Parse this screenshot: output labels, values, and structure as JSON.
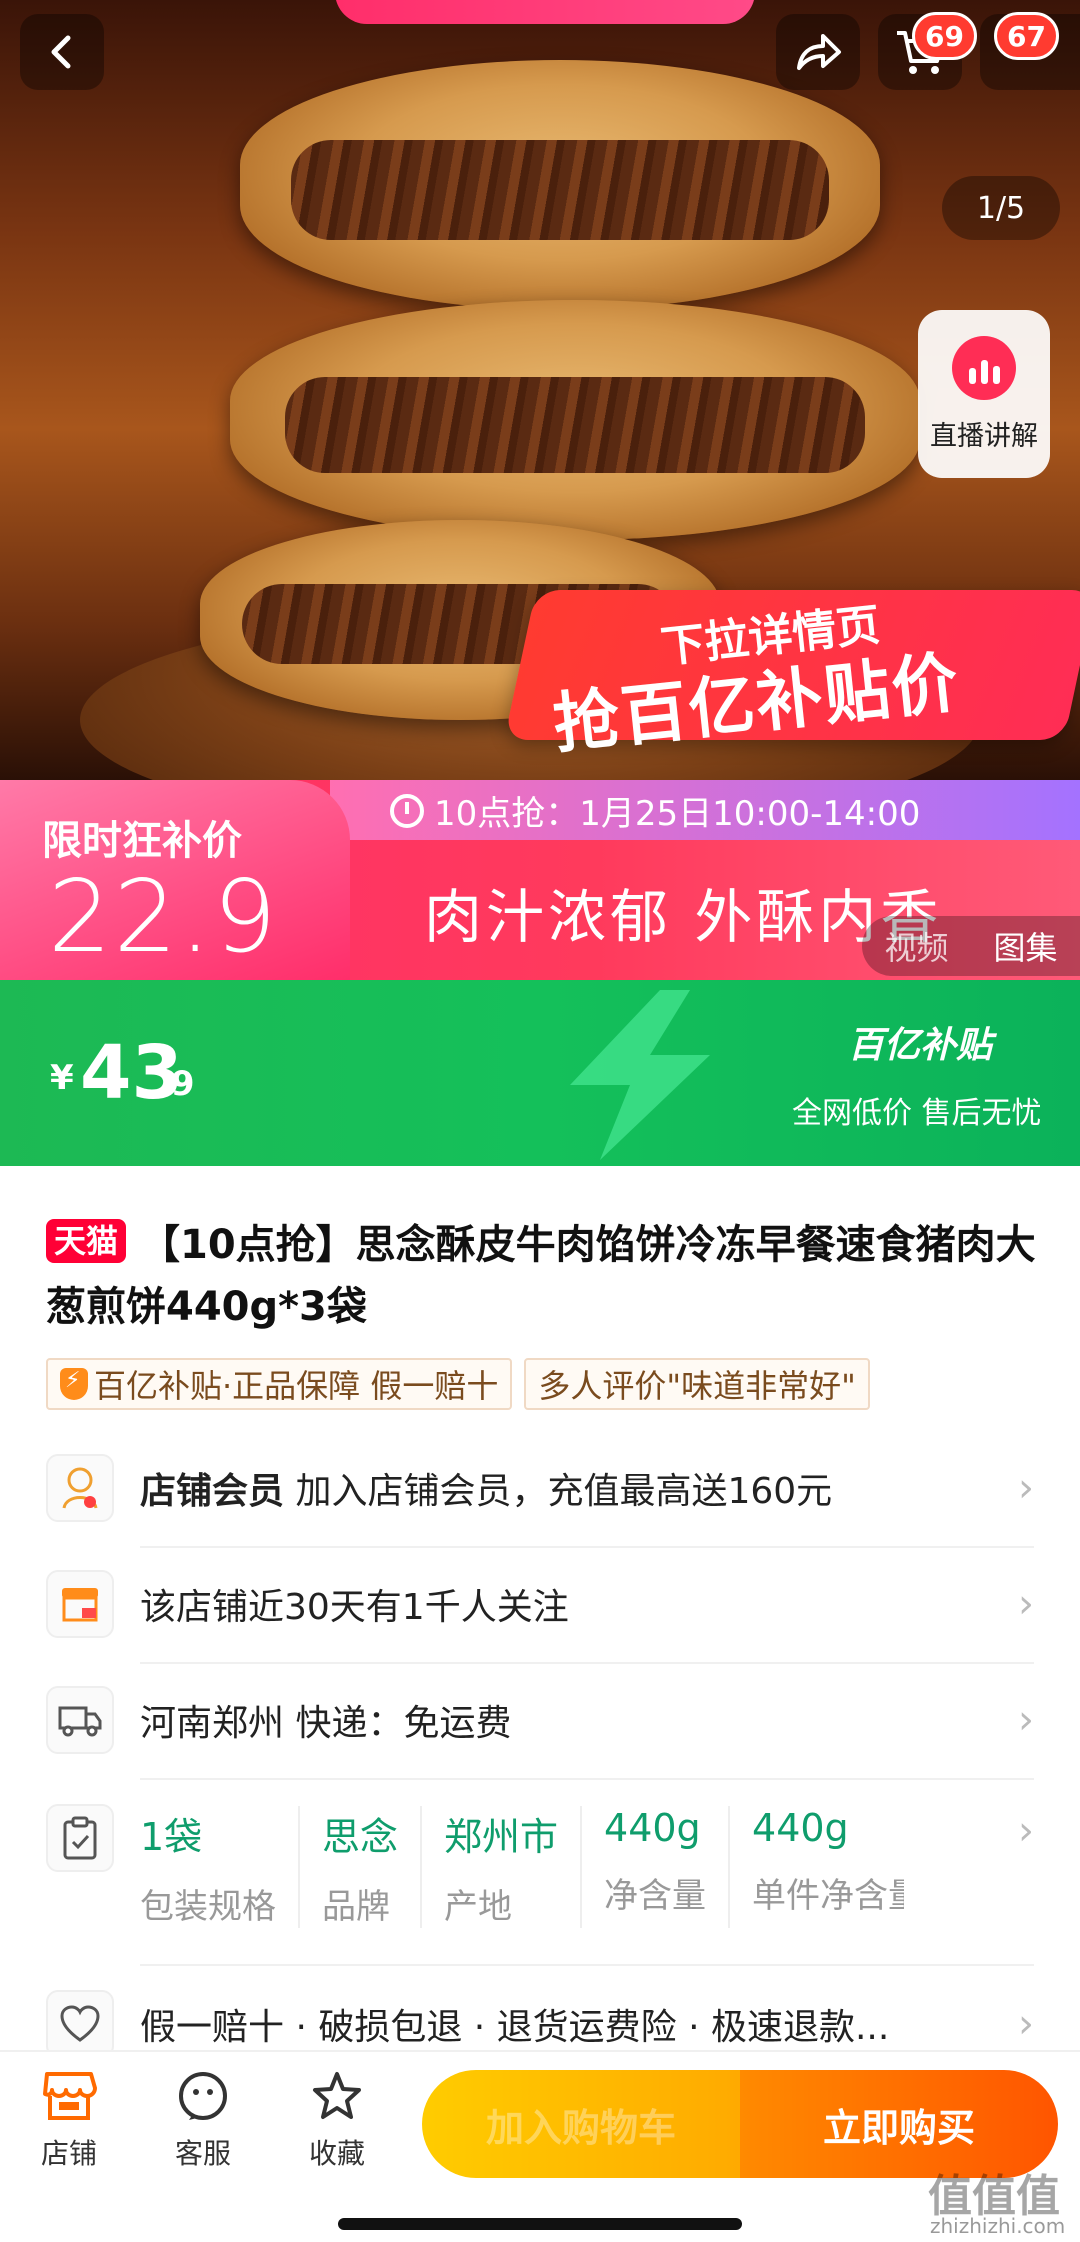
{
  "header": {
    "back_icon": "back-arrow-icon",
    "share_icon": "share-icon",
    "cart_badge": "69",
    "more_badge": "67"
  },
  "hero": {
    "page_indicator": "1/5",
    "live_label": "直播讲解",
    "overlay_line1": "下拉详情页",
    "overlay_line2": "抢百亿补贴价"
  },
  "promo": {
    "flash_title": "限时狂补价",
    "flash_price": "22.9",
    "time_text": "10点抢：1月25日10:00-14:00",
    "slogan": "肉汁浓郁 外酥内香",
    "media_tabs": [
      "视频",
      "图集"
    ]
  },
  "price_bar": {
    "currency": "¥",
    "price_int": "43",
    "price_dec": ".9",
    "subsidy_logo": "百亿补贴",
    "subsidy_desc": "全网低价 售后无忧"
  },
  "product": {
    "platform_badge": "天猫",
    "title": "【10点抢】思念酥皮牛肉馅饼冷冻早餐速食猪肉大葱煎饼440g*3袋",
    "tags": [
      "百亿补贴·正品保障 假一赔十",
      "多人评价\"味道非常好\""
    ]
  },
  "info_rows": {
    "membership_label": "店铺会员",
    "membership_text": "加入店铺会员，充值最高送160元",
    "followers_text": "该店铺近30天有1千人关注",
    "shipping_text": "河南郑州  快递：免运费",
    "guarantee_text": "假一赔十 · 破损包退 · 退货运费险 · 极速退款..."
  },
  "specs": [
    {
      "value": "1袋",
      "key": "包装规格"
    },
    {
      "value": "思念",
      "key": "品牌"
    },
    {
      "value": "郑州市",
      "key": "产地"
    },
    {
      "value": "440g",
      "key": "净含量"
    },
    {
      "value": "440g",
      "key": "单件净含量"
    }
  ],
  "bottom_bar": {
    "shop_label": "店铺",
    "service_label": "客服",
    "favorite_label": "收藏",
    "add_cart_label": "加入购物车",
    "buy_now_label": "立即购买"
  },
  "watermark": {
    "main": "值值值",
    "sub": "zhizhizhi.com"
  },
  "colors": {
    "promo_pink": "#ff2e6a",
    "subsidy_green": "#1db954",
    "spec_green": "#0f9d6c",
    "tmall_red": "#ff0036",
    "buy_orange": "#ff5500"
  }
}
